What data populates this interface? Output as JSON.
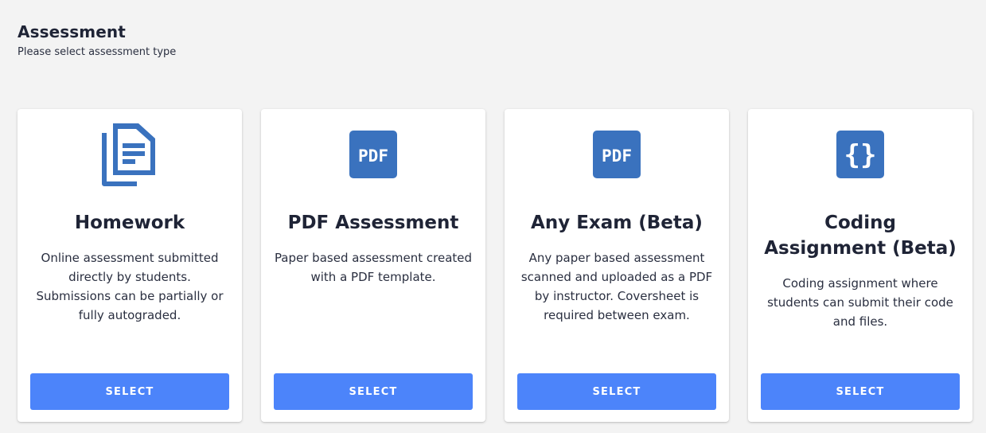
{
  "header": {
    "title": "Assessment",
    "subtitle": "Please select assessment type"
  },
  "colors": {
    "icon": "#3a72be",
    "button": "#4c84fa",
    "text": "#1f2436",
    "background": "#f3f3f3"
  },
  "cards": [
    {
      "icon": "document-icon",
      "title": "Homework",
      "description": "Online assessment submitted directly by students. Submissions can be partially or fully autograded.",
      "button": "SELECT"
    },
    {
      "icon": "pdf-icon",
      "icon_text": "PDF",
      "title": "PDF Assessment",
      "description": "Paper based assessment created with a PDF template.",
      "button": "SELECT"
    },
    {
      "icon": "pdf-icon",
      "icon_text": "PDF",
      "title": "Any Exam (Beta)",
      "description": "Any paper based assessment scanned and uploaded as a PDF by instructor. Coversheet is required between exam.",
      "button": "SELECT"
    },
    {
      "icon": "code-braces-icon",
      "icon_text": "{}",
      "title": "Coding Assignment (Beta)",
      "description": "Coding assignment where students can submit their code and files.",
      "button": "SELECT"
    }
  ]
}
